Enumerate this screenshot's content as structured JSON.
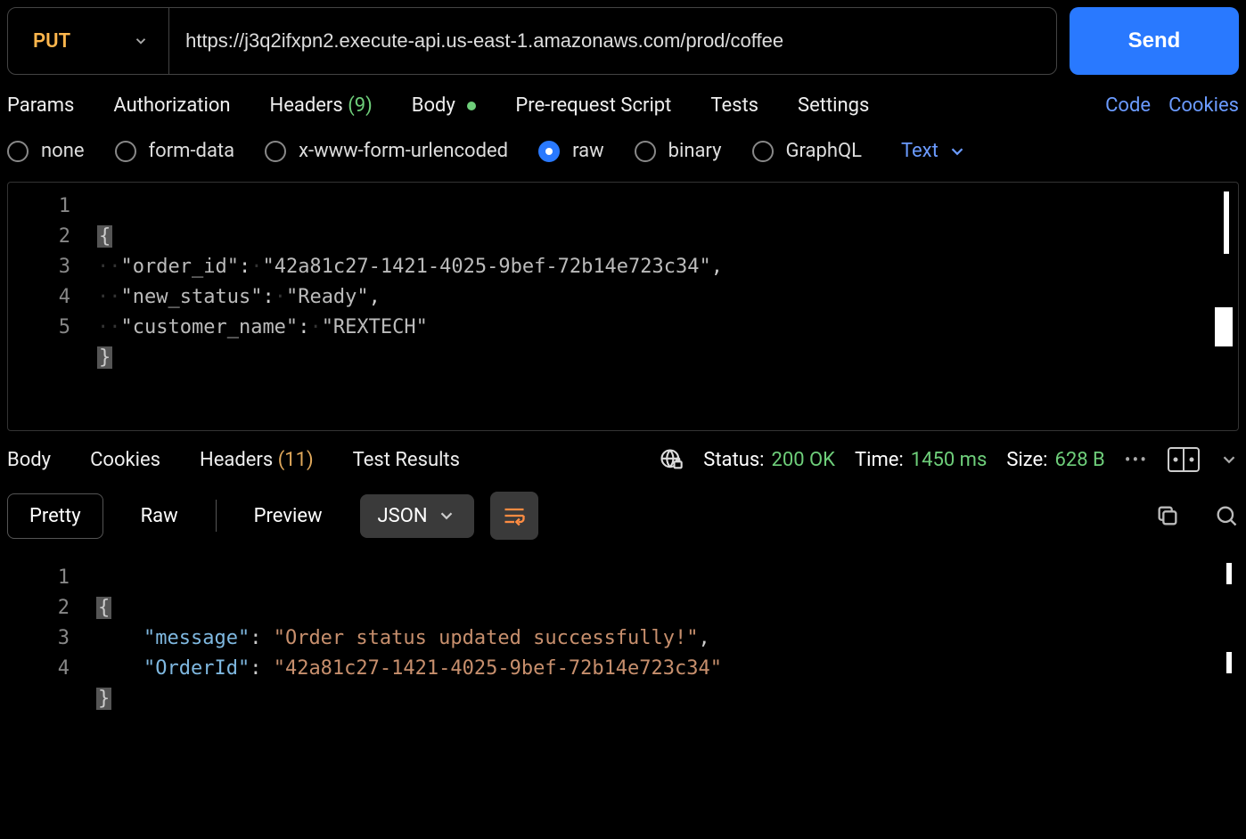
{
  "request": {
    "method": "PUT",
    "url": "https://j3q2ifxpn2.execute-api.us-east-1.amazonaws.com/prod/coffee",
    "send_label": "Send"
  },
  "tabs": {
    "params": "Params",
    "authorization": "Authorization",
    "headers": "Headers",
    "headers_count": "(9)",
    "body": "Body",
    "prerequest": "Pre-request Script",
    "tests": "Tests",
    "settings": "Settings",
    "code": "Code",
    "cookies": "Cookies"
  },
  "body_types": {
    "none": "none",
    "form_data": "form-data",
    "urlencoded": "x-www-form-urlencoded",
    "raw": "raw",
    "binary": "binary",
    "graphql": "GraphQL",
    "format": "Text"
  },
  "request_body": {
    "lines": [
      "1",
      "2",
      "3",
      "4",
      "5"
    ],
    "open": "{",
    "l2_key": "\"order_id\"",
    "l2_val": "\"42a81c27-1421-4025-9bef-72b14e723c34\"",
    "l3_key": "\"new_status\"",
    "l3_val": "\"Ready\"",
    "l4_key": "\"customer_name\"",
    "l4_val": "\"REXTECH\"",
    "close": "}"
  },
  "response_tabs": {
    "body": "Body",
    "cookies": "Cookies",
    "headers": "Headers",
    "headers_count": "(11)",
    "test_results": "Test Results"
  },
  "status": {
    "status_label": "Status:",
    "status_value": "200 OK",
    "time_label": "Time:",
    "time_value": "1450 ms",
    "size_label": "Size:",
    "size_value": "628 B"
  },
  "response_controls": {
    "pretty": "Pretty",
    "raw": "Raw",
    "preview": "Preview",
    "format": "JSON"
  },
  "response_body": {
    "lines": [
      "1",
      "2",
      "3",
      "4"
    ],
    "open": "{",
    "l2_key": "\"message\"",
    "l2_val": "\"Order status updated successfully!\"",
    "l3_key": "\"OrderId\"",
    "l3_val": "\"42a81c27-1421-4025-9bef-72b14e723c34\"",
    "close": "}"
  }
}
